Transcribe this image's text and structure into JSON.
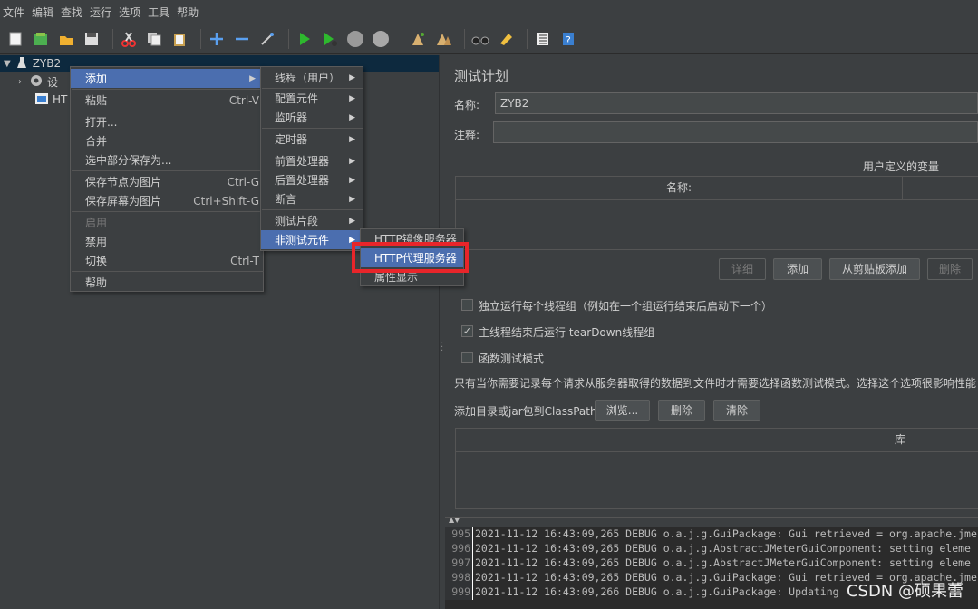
{
  "menubar": [
    "文件",
    "编辑",
    "查找",
    "运行",
    "选项",
    "工具",
    "帮助"
  ],
  "toolbar_icons": [
    "new-icon",
    "templates-icon",
    "open-icon",
    "save-icon",
    "cut-icon",
    "copy-icon",
    "paste-icon",
    "expand-icon",
    "collapse-icon",
    "toggle-icon",
    "start-icon",
    "start-no-pause-icon",
    "stop-icon",
    "shutdown-icon",
    "clear-icon",
    "clear-all-icon",
    "search-icon",
    "reset-search-icon",
    "function-helper-icon",
    "help-icon"
  ],
  "tree": {
    "root": "ZYB2",
    "child1": "设",
    "child2": "HT"
  },
  "context_menu": {
    "items": [
      {
        "label": "添加",
        "arrow": true
      },
      {
        "label": "粘贴",
        "shortcut": "Ctrl-V"
      },
      {
        "label": "打开..."
      },
      {
        "label": "合并"
      },
      {
        "label": "选中部分保存为..."
      },
      {
        "label": "保存节点为图片",
        "shortcut": "Ctrl-G"
      },
      {
        "label": "保存屏幕为图片",
        "shortcut": "Ctrl+Shift-G"
      },
      {
        "label": "启用"
      },
      {
        "label": "禁用"
      },
      {
        "label": "切换",
        "shortcut": "Ctrl-T"
      },
      {
        "label": "帮助"
      }
    ]
  },
  "submenu_add": {
    "items": [
      "线程（用户）",
      "配置元件",
      "监听器",
      "定时器",
      "前置处理器",
      "后置处理器",
      "断言",
      "测试片段",
      "非测试元件"
    ]
  },
  "submenu_nontest": {
    "items": [
      "HTTP镜像服务器",
      "HTTP代理服务器",
      "属性显示"
    ]
  },
  "panel": {
    "title": "测试计划",
    "name_label": "名称:",
    "name_value": "ZYB2",
    "comment_label": "注释:",
    "user_vars_title": "用户定义的变量",
    "col_name": "名称:",
    "btn_detail": "详细",
    "btn_add": "添加",
    "btn_clipboard": "从剪贴板添加",
    "btn_delete": "删除",
    "cb1": "独立运行每个线程组（例如在一个组运行结束后启动下一个）",
    "cb2": "主线程结束后运行 tearDown线程组",
    "cb3": "函数测试模式",
    "note": "只有当你需要记录每个请求从服务器取得的数据到文件时才需要选择函数测试模式。选择这个选项很影响性能",
    "classpath_label": "添加目录或jar包到ClassPath",
    "btn_browse": "浏览...",
    "btn_delete2": "删除",
    "btn_clear": "清除",
    "lib_col": "库"
  },
  "log": {
    "lines": [
      {
        "num": "995",
        "text": "2021-11-12 16:43:09,265 DEBUG o.a.j.g.GuiPackage: Gui retrieved = org.apache.jme"
      },
      {
        "num": "996",
        "text": "2021-11-12 16:43:09,265 DEBUG o.a.j.g.AbstractJMeterGuiComponent: setting eleme"
      },
      {
        "num": "997",
        "text": "2021-11-12 16:43:09,265 DEBUG o.a.j.g.AbstractJMeterGuiComponent: setting eleme"
      },
      {
        "num": "998",
        "text": "2021-11-12 16:43:09,265 DEBUG o.a.j.g.GuiPackage: Gui retrieved = org.apache.jme"
      },
      {
        "num": "999",
        "text": "2021-11-12 16:43:09,266 DEBUG o.a.j.g.GuiPackage: Updating"
      }
    ]
  },
  "watermark": "CSDN @硕果蕾",
  "colors": {
    "highlight": "#4b6eaf",
    "redbox": "#e8252a",
    "background": "#3c3f41"
  }
}
